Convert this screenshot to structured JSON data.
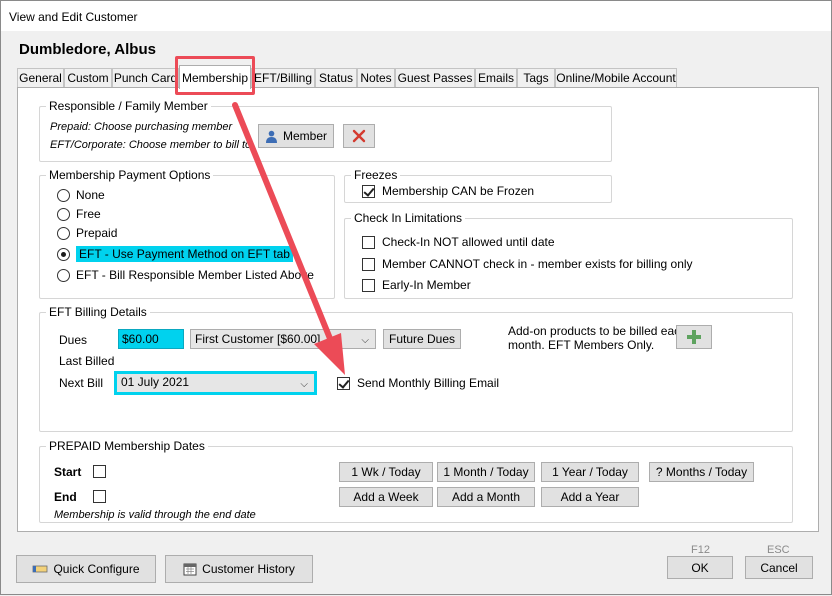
{
  "window": {
    "title": "View and Edit Customer"
  },
  "customer": {
    "name": "Dumbledore, Albus"
  },
  "tabs": [
    {
      "label": "General"
    },
    {
      "label": "Custom"
    },
    {
      "label": "Punch Card"
    },
    {
      "label": "Membership"
    },
    {
      "label": "EFT/Billing"
    },
    {
      "label": "Status"
    },
    {
      "label": "Notes"
    },
    {
      "label": "Guest Passes"
    },
    {
      "label": "Emails"
    },
    {
      "label": "Tags"
    },
    {
      "label": "Online/Mobile Account"
    }
  ],
  "active_tab": "Membership",
  "responsible": {
    "title": "Responsible / Family Member",
    "line1": "Prepaid:  Choose purchasing member",
    "line2": "EFT/Corporate: Choose member to bill to",
    "member_button": "Member",
    "icons": {
      "member": "person-icon",
      "remove": "red-x-icon"
    }
  },
  "payment_options": {
    "title": "Membership Payment Options",
    "options": [
      {
        "label": "None",
        "selected": false
      },
      {
        "label": "Free",
        "selected": false
      },
      {
        "label": "Prepaid",
        "selected": false
      },
      {
        "label": "EFT - Use Payment Method on EFT tab",
        "selected": true
      },
      {
        "label": "EFT - Bill Responsible Member Listed Above",
        "selected": false
      }
    ]
  },
  "freezes": {
    "title": "Freezes",
    "can_freeze": {
      "label": "Membership CAN be Frozen",
      "checked": true
    }
  },
  "checkin": {
    "title": "Check In Limitations",
    "items": [
      {
        "label": "Check-In NOT allowed until date",
        "checked": false
      },
      {
        "label": "Member CANNOT check in - member exists for billing only",
        "checked": false
      },
      {
        "label": "Early-In Member",
        "checked": false
      }
    ]
  },
  "eft": {
    "title": "EFT Billing Details",
    "dues_label": "Dues",
    "dues_value": "$60.00",
    "plan_value": "First Customer [$60.00]",
    "future_dues_button": "Future Dues",
    "last_billed_label": "Last Billed",
    "next_bill_label": "Next Bill",
    "next_bill_value": "01 July 2021",
    "send_email": {
      "label": "Send Monthly Billing Email",
      "checked": true
    },
    "addon_text_1": "Add-on products to be billed each",
    "addon_text_2": "month. EFT Members Only.",
    "add_icon": "plus-icon"
  },
  "prepaid": {
    "title": "PREPAID Membership Dates",
    "start_label": "Start",
    "end_label": "End",
    "note": "Membership is valid through the end date",
    "row1": [
      "1 Wk / Today",
      "1 Month / Today",
      "1 Year / Today",
      "? Months / Today"
    ],
    "row2": [
      "Add a Week",
      "Add a Month",
      "Add a Year"
    ]
  },
  "footer": {
    "quick_configure": "Quick Configure",
    "customer_history": "Customer History",
    "ok_label": "OK",
    "ok_key": "F12",
    "cancel_label": "Cancel",
    "cancel_key": "ESC",
    "icons": {
      "quick": "pencil-icon",
      "history": "calendar-icon"
    }
  },
  "colors": {
    "highlight": "#00d2ee",
    "annotation": "#ec4b57"
  }
}
